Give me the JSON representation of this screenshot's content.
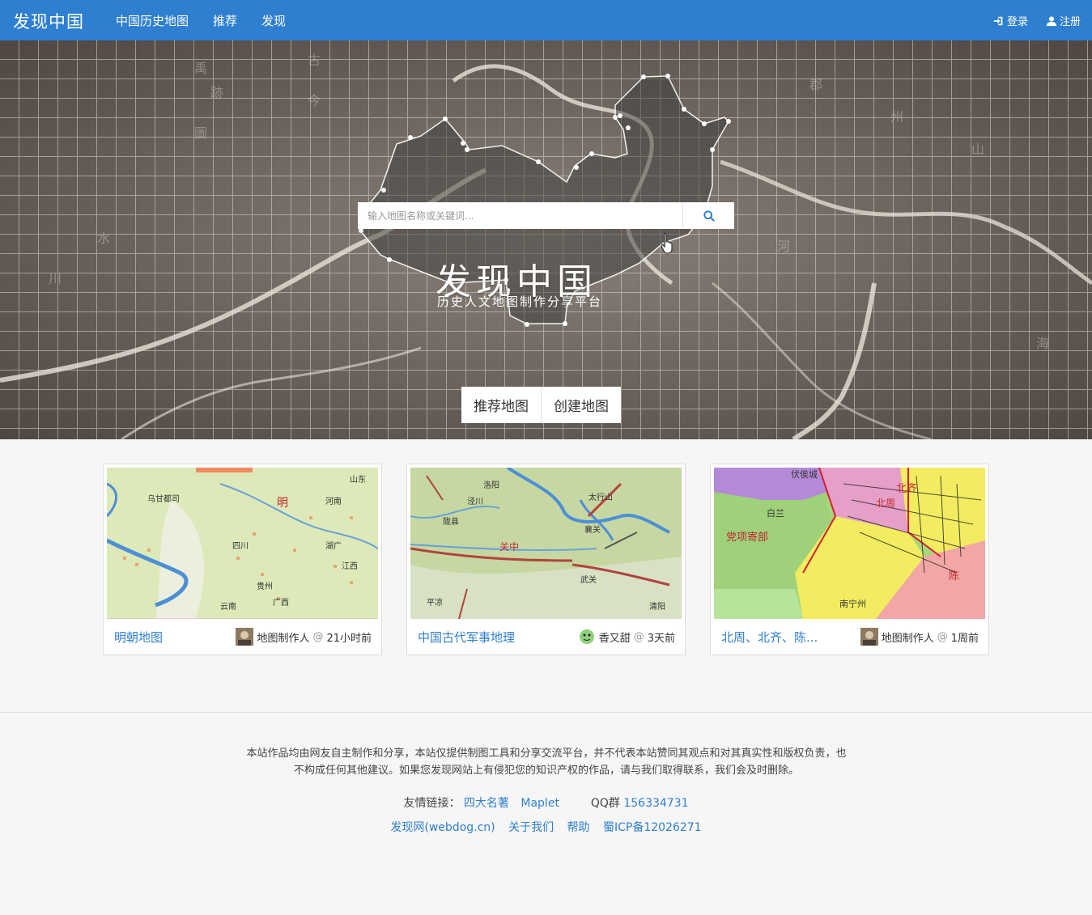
{
  "navbar": {
    "brand": "发现中国",
    "links": [
      "中国历史地图",
      "推荐",
      "发现"
    ],
    "login": "登录",
    "register": "注册"
  },
  "hero": {
    "search_placeholder": "输入地图名称或关键词...",
    "title": "发现中国",
    "subtitle": "历史人文地图制作分享平台",
    "btn_recommend": "推荐地图",
    "btn_create": "创建地图"
  },
  "cards": [
    {
      "title": "明朝地图",
      "author": "地图制作人",
      "at": "@",
      "time": "21小时前"
    },
    {
      "title": "中国古代军事地理",
      "author": "香又甜",
      "at": "@",
      "time": "3天前"
    },
    {
      "title": "北周、北齐、陈...",
      "author": "地图制作人",
      "at": "@",
      "time": "1周前"
    }
  ],
  "map_labels": {
    "ming": [
      "明",
      "山东",
      "河南",
      "四川",
      "湖广",
      "贵州",
      "广西",
      "云南",
      "江西",
      "乌甘都司"
    ],
    "military": [
      "关中",
      "襄关",
      "武关",
      "陇县",
      "泾川",
      "平凉",
      "洛阳",
      "太行山",
      "清阳"
    ],
    "zhou": [
      "党项寄部",
      "北齐",
      "陈",
      "白兰",
      "伏俟城",
      "南宁州",
      "北周"
    ]
  },
  "footer": {
    "notice_line1": "本站作品均由网友自主制作和分享，本站仅提供制图工具和分享交流平台，并不代表本站赞同其观点和对其真实性和版权负责，也",
    "notice_line2": "不构成任何其他建议。如果您发现网站上有侵犯您的知识产权的作品，请与我们取得联系，我们会及时删除。",
    "friend_links_label": "友情链接：",
    "friend_links": [
      "四大名著",
      "Maplet"
    ],
    "qq_label": "QQ群",
    "qq_number": "156334731",
    "bottom_links": [
      "发现网(webdog.cn)",
      "关于我们",
      "帮助",
      "蜀ICP备12026271"
    ]
  }
}
